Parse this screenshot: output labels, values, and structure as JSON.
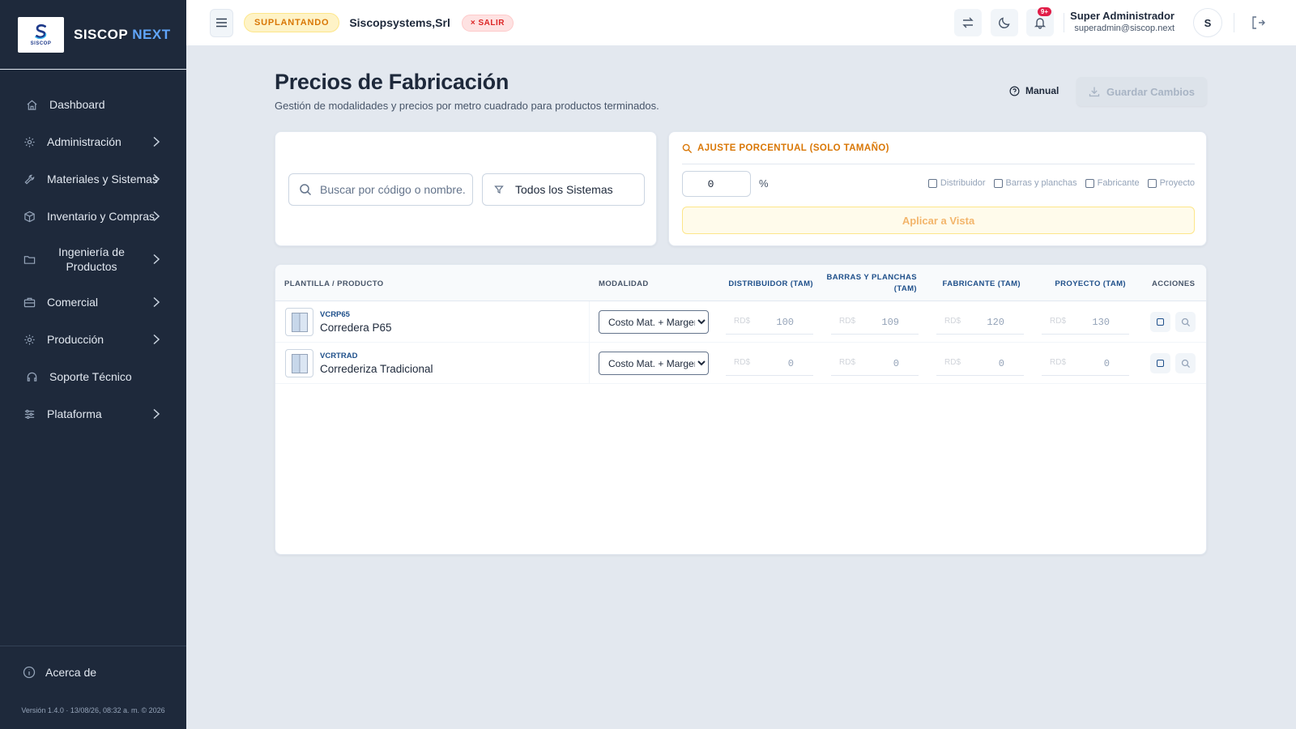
{
  "brand": {
    "logo_text": "SISCOP",
    "name": "SISCOP",
    "name_accent": "NEXT"
  },
  "sidebar": {
    "items": [
      {
        "label": "Dashboard",
        "icon": "home-icon"
      },
      {
        "label": "Administración",
        "icon": "gear-icon"
      },
      {
        "label": "Materiales y Sistemas",
        "icon": "wrench-icon"
      },
      {
        "label": "Inventario y Compras",
        "icon": "box-icon"
      },
      {
        "label": "Ingeniería de Productos",
        "icon": "folder-icon"
      },
      {
        "label": "Comercial",
        "icon": "briefcase-icon"
      },
      {
        "label": "Producción",
        "icon": "gear-icon"
      },
      {
        "label": "Soporte Técnico",
        "icon": "headset-icon"
      },
      {
        "label": "Plataforma",
        "icon": "sliders-icon"
      }
    ],
    "about": "Acerca de",
    "version": "Versión 1.4.0 · 13/08/26, 08:32 a. m. © 2026"
  },
  "topbar": {
    "impersonating": "SUPLANTANDO",
    "company": "Siscopsystems,Srl",
    "exit": "× SALIR",
    "notifications": "9+",
    "user_name": "Super Administrador",
    "user_email": "superadmin@siscop.next",
    "avatar": "S"
  },
  "page": {
    "title": "Precios de Fabricación",
    "subtitle": "Gestión de modalidades y precios por metro cuadrado para productos terminados.",
    "manual": "Manual",
    "save": "Guardar Cambios"
  },
  "filters": {
    "search_placeholder": "Buscar por código o nombre...",
    "system": "Todos los Sistemas"
  },
  "adjust": {
    "title": "AJUSTE PORCENTUAL (SOLO TAMAÑO)",
    "value": "0",
    "unit": "%",
    "options": [
      "Distribuidor",
      "Barras y planchas",
      "Fabricante",
      "Proyecto"
    ],
    "apply": "Aplicar a Vista"
  },
  "table": {
    "headers": {
      "product": "PLANTILLA / PRODUCTO",
      "modality": "MODALIDAD",
      "distributor": "DISTRIBUIDOR (TAM)",
      "bars_1": "BARRAS Y PLANCHAS",
      "bars_2": "(TAM)",
      "manufacturer": "FABRICANTE (TAM)",
      "project": "PROYECTO (TAM)",
      "actions": "ACCIONES"
    },
    "currency": "RD$",
    "rows": [
      {
        "code": "VCRP65",
        "name": "Corredera P65",
        "modality": "Costo Mat. + Margen",
        "prices": [
          "100",
          "109",
          "120",
          "130"
        ]
      },
      {
        "code": "VCRTRAD",
        "name": "Correderiza Tradicional",
        "modality": "Costo Mat. + Margen",
        "prices": [
          "0",
          "0",
          "0",
          "0"
        ]
      }
    ]
  }
}
